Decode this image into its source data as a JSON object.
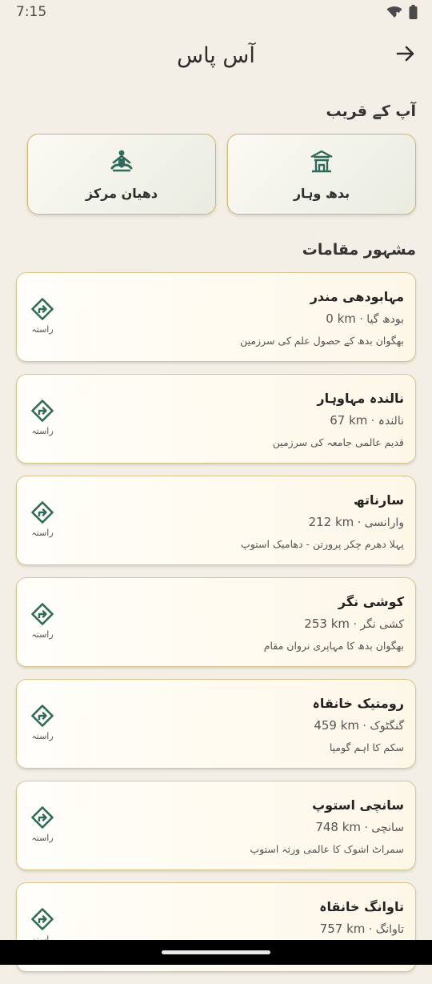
{
  "status_bar": {
    "time": "7:15"
  },
  "header": {
    "title": "آس پاس"
  },
  "nearby": {
    "title": "آپ کے قریب",
    "items": [
      {
        "label": "بدھ وہار",
        "icon": "temple-icon"
      },
      {
        "label": "دھیان مرکز",
        "icon": "meditation-icon"
      }
    ]
  },
  "famous": {
    "title": "مشہور مقامات",
    "route_label": "راستہ",
    "places": [
      {
        "name": "مہابودھی مندر",
        "location": "بودھ گیا",
        "distance": "0 km",
        "description": "بھگوان بدھ کے حصول علم کی سرزمین"
      },
      {
        "name": "نالندہ مہاوہار",
        "location": "نالندہ",
        "distance": "67 km",
        "description": "قدیم عالمی جامعہ کی سرزمین"
      },
      {
        "name": "سارناتھ",
        "location": "وارانسی",
        "distance": "212 km",
        "description": "پہلا دھرم چکر پرورتن - دھامیک استوپ"
      },
      {
        "name": "کوشی نگر",
        "location": "کشی نگر",
        "distance": "253 km",
        "description": "بھگوان بدھ کا مہاپری نروان مقام"
      },
      {
        "name": "رومتیک خانقاہ",
        "location": "گنگٹوک",
        "distance": "459 km",
        "description": "سکم کا اہم گومپا"
      },
      {
        "name": "سانچی استوپ",
        "location": "سانچی",
        "distance": "748 km",
        "description": "سمراٹ اشوک کا عالمی ورثہ استوپ"
      },
      {
        "name": "تاوانگ خانقاہ",
        "location": "تاوانگ",
        "distance": "757 km",
        "description": ""
      }
    ]
  },
  "colors": {
    "accent": "#2e6b5a",
    "border_gold": "#d4b46a",
    "background": "#f3efe6"
  }
}
